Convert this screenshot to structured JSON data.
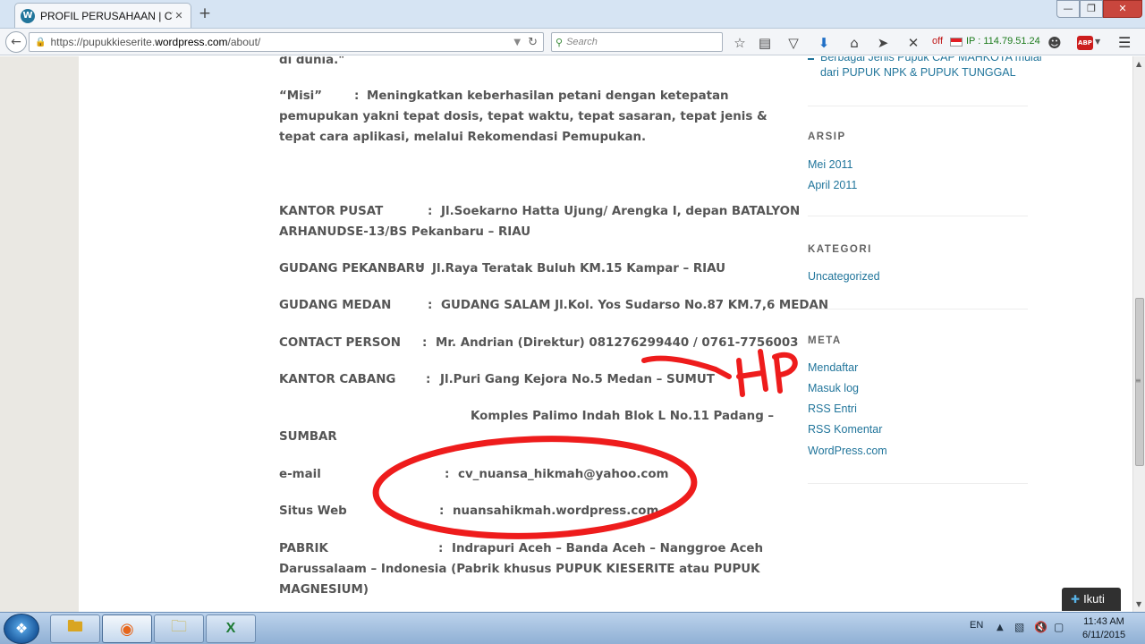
{
  "browser": {
    "tab_title": "PROFIL PERUSAHAAN | CV...",
    "tab_favicon": "W",
    "tab_close": "✕",
    "new_tab": "+",
    "url_prefix": "https://pupukkieserite.",
    "url_domain": "wordpress.com",
    "url_path": "/about/",
    "search_placeholder": "Search",
    "ip_status": "off",
    "ip_text": "IP : 114.79.51.24",
    "abp_label": "ABP",
    "icons": [
      "back-icon",
      "lock-icon",
      "reload-icon",
      "search-icon",
      "star-icon",
      "reading-list-icon",
      "pocket-icon",
      "download-icon",
      "home-icon",
      "send-icon",
      "x-icon",
      "chat-icon",
      "menu-icon"
    ]
  },
  "window_controls": {
    "minimize": "—",
    "maximize": "❐",
    "close": "✕"
  },
  "article": {
    "top_fragment": "di dunia.\"",
    "misi_label": "“Misi”",
    "misi_sep": ":",
    "misi_text": "Meningkatkan keberhasilan petani dengan ketepatan pemupukan yakni tepat dosis, tepat waktu, tepat sasaran, tepat jenis & tepat cara aplikasi, melalui Rekomendasi Pemupukan.",
    "rows": [
      {
        "label": "KANTOR PUSAT",
        "sep": ":",
        "value": "Jl.Soekarno Hatta Ujung/ Arengka I, depan  BATALYON",
        "value2": "ARHANUDSE-13/BS Pekanbaru – RIAU"
      },
      {
        "label": "GUDANG PEKANBARU",
        "sep": ":",
        "value": "Jl.Raya Teratak Buluh KM.15 Kampar – RIAU"
      },
      {
        "label": "GUDANG MEDAN",
        "sep": ":",
        "value": "GUDANG SALAM Jl.Kol. Yos Sudarso No.87 KM.7,6 MEDAN"
      },
      {
        "label": "CONTACT PERSON",
        "sep": ":",
        "value": "Mr. Andrian (Direktur) 081276299440 / 0761-7756003"
      },
      {
        "label": "KANTOR CABANG",
        "sep": ":",
        "value": "Jl.Puri Gang Kejora No.5 Medan – SUMUT"
      },
      {
        "value": "Komples Palimo Indah Blok L No.11 Padang –",
        "value2": "SUMBAR"
      },
      {
        "label": "e-mail",
        "sep": ":",
        "value": "cv_nuansa_hikmah@yahoo.com"
      },
      {
        "label": "Situs Web",
        "sep": ":",
        "value": "nuansahikmah.wordpress.com"
      },
      {
        "label": "PABRIK",
        "sep": ":",
        "value": "Indrapuri Aceh – Banda Aceh – Nanggroe Aceh",
        "value2": "Darussalaam – Indonesia (Pabrik khusus PUPUK KIESERITE atau PUPUK",
        "value3": "MAGNESIUM)"
      }
    ]
  },
  "annotation": {
    "text": "HP",
    "color": "#ee1c1c"
  },
  "sidebar": {
    "recent_post_line1": "Berbagai Jenis Pupuk CAP MAHKOTA mulai",
    "recent_post_line2": "dari PUPUK NPK & PUPUK TUNGGAL",
    "arsip_title": "ARSIP",
    "arsip": [
      "Mei 2011",
      "April 2011"
    ],
    "kategori_title": "KATEGORI",
    "kategori": [
      "Uncategorized"
    ],
    "meta_title": "META",
    "meta": [
      "Mendaftar",
      "Masuk log",
      "RSS Entri",
      "RSS Komentar",
      "WordPress.com"
    ]
  },
  "follow_button": {
    "label": "Ikuti",
    "icon": "plus-circle-icon"
  },
  "taskbar": {
    "language": "EN",
    "time": "11:43 AM",
    "date": "6/11/2015",
    "apps": [
      "windows-explorer-icon",
      "firefox-icon",
      "folder-icon",
      "excel-icon"
    ]
  },
  "colors": {
    "link": "#21759b",
    "body_text": "#555555",
    "marker": "#ee1c1c"
  }
}
